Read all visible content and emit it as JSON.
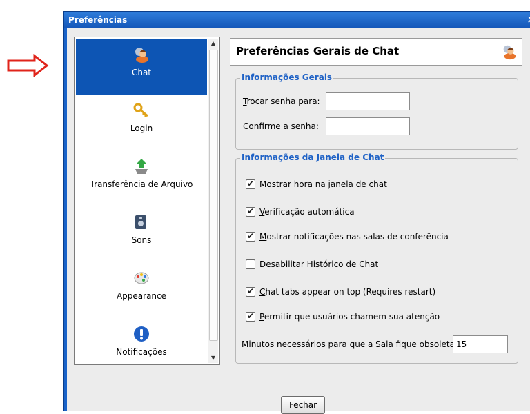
{
  "window": {
    "title": "Preferências",
    "close_glyph": "✕"
  },
  "nav": {
    "items": [
      {
        "label": "Chat",
        "icon": "chat-user-icon",
        "selected": true
      },
      {
        "label": "Login",
        "icon": "key-icon",
        "selected": false
      },
      {
        "label": "Transferência de Arquivo",
        "icon": "file-transfer-icon",
        "selected": false
      },
      {
        "label": "Sons",
        "icon": "speaker-icon",
        "selected": false
      },
      {
        "label": "Appearance",
        "icon": "palette-icon",
        "selected": false
      },
      {
        "label": "Notificações",
        "icon": "info-icon",
        "selected": false
      }
    ],
    "scroll_up": "▲",
    "scroll_down": "▼"
  },
  "panel": {
    "title": "Preferências Gerais de Chat",
    "general_group": {
      "title": "Informações Gerais",
      "change_password_label_u": "T",
      "change_password_label_rest": "rocar senha para:",
      "change_password_value": "",
      "confirm_label_u": "C",
      "confirm_label_rest": "onfirme a senha:",
      "confirm_value": ""
    },
    "chat_group": {
      "title": "Informações da Janela de Chat",
      "options": [
        {
          "u": "M",
          "rest": "ostrar hora na janela de chat",
          "checked": true
        },
        {
          "u": "V",
          "rest": "erificação automática",
          "checked": true
        },
        {
          "u": "M",
          "rest": "ostrar notificações nas salas de conferência",
          "checked": true
        },
        {
          "u": "D",
          "rest": "esabilitar Histórico de Chat",
          "checked": false
        },
        {
          "u": "C",
          "rest": "hat tabs appear on top (Requires restart)",
          "checked": true
        },
        {
          "u": "P",
          "rest": "ermitir que usuários chamem sua atenção",
          "checked": true
        }
      ],
      "idle_label_u": "M",
      "idle_label_rest": "inutos necessários para que a Sala fique obsoleta:",
      "idle_value": "15"
    }
  },
  "footer": {
    "close_label": "Fechar"
  },
  "colors": {
    "accent": "#0d55b4",
    "group_title": "#1f62c6",
    "annotation_arrow": "#e0241b"
  }
}
